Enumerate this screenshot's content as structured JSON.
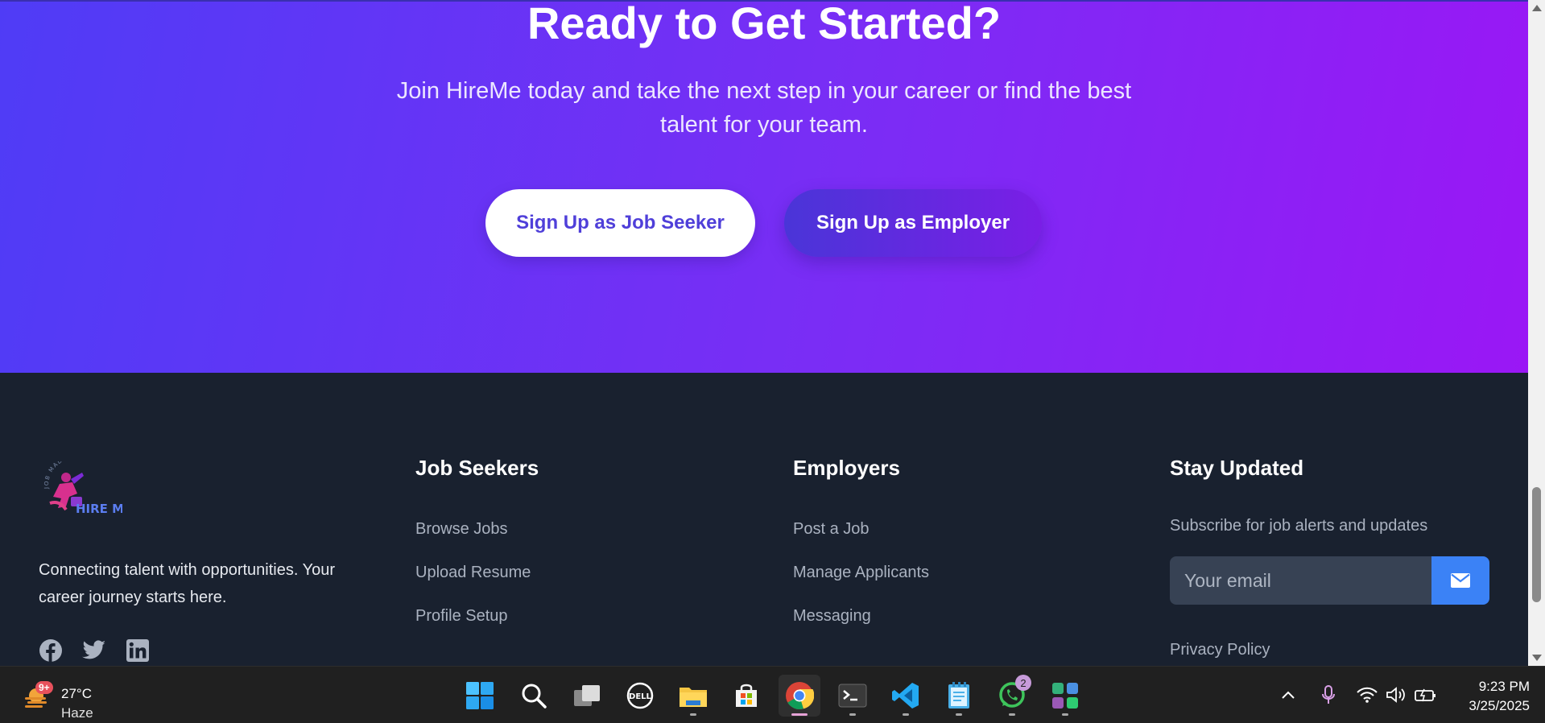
{
  "cta": {
    "title": "Ready to Get Started?",
    "subtitle": "Join HireMe today and take the next step in your career or find the best talent for your team.",
    "seeker_button": "Sign Up as Job Seeker",
    "employer_button": "Sign Up as Employer"
  },
  "footer": {
    "logo_text": "HIRE ME",
    "logo_arc_text": "JOB MADE EASY",
    "tagline": "Connecting talent with opportunities. Your career journey starts here.",
    "socials": [
      "facebook-icon",
      "twitter-icon",
      "linkedin-icon"
    ],
    "job_seekers": {
      "title": "Job Seekers",
      "links": [
        "Browse Jobs",
        "Upload Resume",
        "Profile Setup"
      ]
    },
    "employers": {
      "title": "Employers",
      "links": [
        "Post a Job",
        "Manage Applicants",
        "Messaging"
      ]
    },
    "stay_updated": {
      "title": "Stay Updated",
      "subtitle": "Subscribe for job alerts and updates",
      "email_placeholder": "Your email",
      "privacy_link": "Privacy Policy"
    }
  },
  "taskbar": {
    "weather": {
      "badge": "9+",
      "temp": "27°C",
      "condition": "Haze"
    },
    "apps": [
      "start-icon",
      "search-icon",
      "task-view-icon",
      "dell-icon",
      "file-explorer-icon",
      "microsoft-store-icon",
      "chrome-icon",
      "terminal-icon",
      "vscode-icon",
      "notepad-icon",
      "whatsapp-icon",
      "app-icon"
    ],
    "whatsapp_badge": "2",
    "clock": {
      "time": "9:23 PM",
      "date": "3/25/2025"
    }
  },
  "colors": {
    "cta_gradient_start": "#4f3cf6",
    "cta_gradient_end": "#9a17f5",
    "footer_bg": "#19212f",
    "accent_blue": "#3b82f6"
  }
}
